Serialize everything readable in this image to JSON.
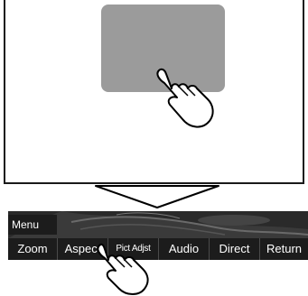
{
  "menu_label": "Menu",
  "buttons": [
    {
      "label": "Zoom",
      "name": "zoom-button"
    },
    {
      "label": "Aspect",
      "name": "aspect-button"
    },
    {
      "label": "Pict Adjst",
      "name": "pict-adjst-button"
    },
    {
      "label": "Audio",
      "name": "audio-button"
    },
    {
      "label": "Direct",
      "name": "direct-button"
    },
    {
      "label": "Return",
      "name": "return-button"
    }
  ],
  "colors": {
    "touch_area": "#9b9b9b",
    "panel_bg": "#2b2b2b",
    "button_text": "#ffffff"
  },
  "icons": {
    "top": "pointing-hand-icon",
    "arrow": "down-triangle-arrow-icon",
    "bottom": "pointing-hand-icon"
  }
}
